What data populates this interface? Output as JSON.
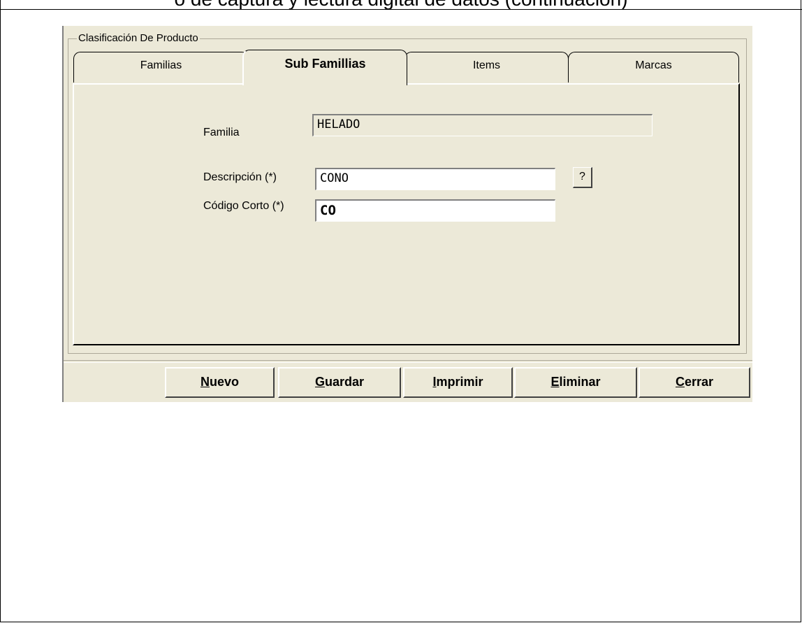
{
  "document": {
    "caption": "o de captura y lectura digital de datos (continuación)"
  },
  "dialog": {
    "group_title": "Clasificación De Producto",
    "tabs": [
      {
        "label": "Familias",
        "active": false
      },
      {
        "label": "Sub Famillias",
        "active": true
      },
      {
        "label": "Items",
        "active": false
      },
      {
        "label": "Marcas",
        "active": false
      }
    ],
    "form": {
      "familia_label": "Familia",
      "familia_value": "HELADO",
      "descripcion_label": "Descripción (*)",
      "descripcion_value": "CONO",
      "lookup_button": "?",
      "codigo_label": "Código Corto (*)",
      "codigo_value": "CO"
    },
    "buttons": {
      "nuevo": {
        "label": "Nuevo",
        "underline": "N",
        "rest": "uevo"
      },
      "guardar": {
        "label": "Guardar",
        "underline": "G",
        "rest": "uardar"
      },
      "imprimir": {
        "label": "Imprimir",
        "underline": "I",
        "rest": "mprimir"
      },
      "eliminar": {
        "label": "Eliminar",
        "underline": "E",
        "rest": "liminar"
      },
      "cerrar": {
        "label": "Cerrar",
        "underline": "C",
        "rest": "errar"
      }
    }
  },
  "colors": {
    "dialog_bg": "#ece9d8",
    "page_bg": "#ffffff",
    "field_bg": "#ffffff"
  }
}
